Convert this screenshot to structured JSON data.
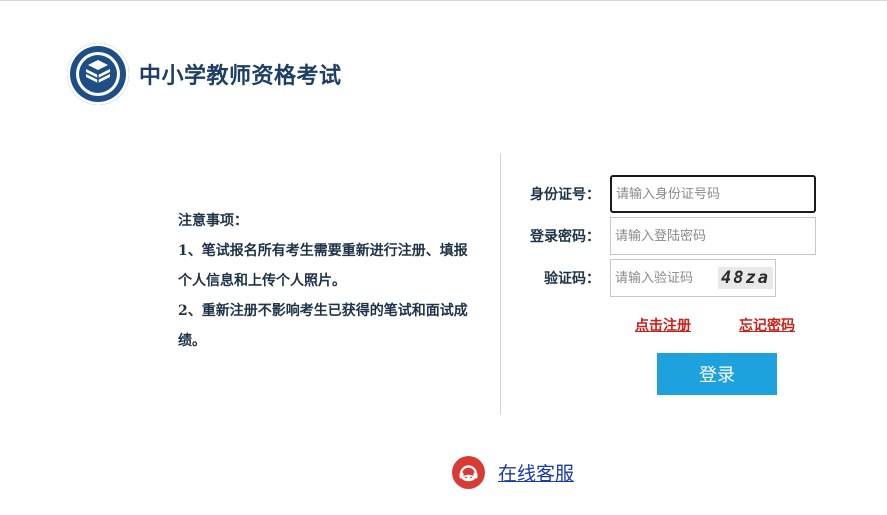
{
  "header": {
    "site_title": "中小学教师资格考试",
    "logo_icon": "book-emblem-icon"
  },
  "notice": {
    "heading": "注意事项：",
    "items": [
      "1、笔试报名所有考生需要重新进行注册、填报个人信息和上传个人照片。",
      "2、重新注册不影响考生已获得的笔试和面试成绩。"
    ]
  },
  "form": {
    "id_label": "身份证号：",
    "id_placeholder": "请输入身份证号码",
    "id_value": "",
    "password_label": "登录密码：",
    "password_placeholder": "请输入登陆密码",
    "password_value": "",
    "code_label": "验证码：",
    "code_placeholder": "请输入验证码",
    "code_value": "",
    "captcha_text": "48za"
  },
  "links": {
    "register": "点击注册",
    "forgot_password": "忘记密码"
  },
  "login_button": "登录",
  "service": {
    "label": "在线客服",
    "icon": "customer-service-icon"
  },
  "colors": {
    "brand_blue": "#1d4f86",
    "button_blue": "#1ea2dd",
    "link_red": "#c8211a",
    "service_red": "#d83a34",
    "service_link": "#1a3aa8"
  }
}
